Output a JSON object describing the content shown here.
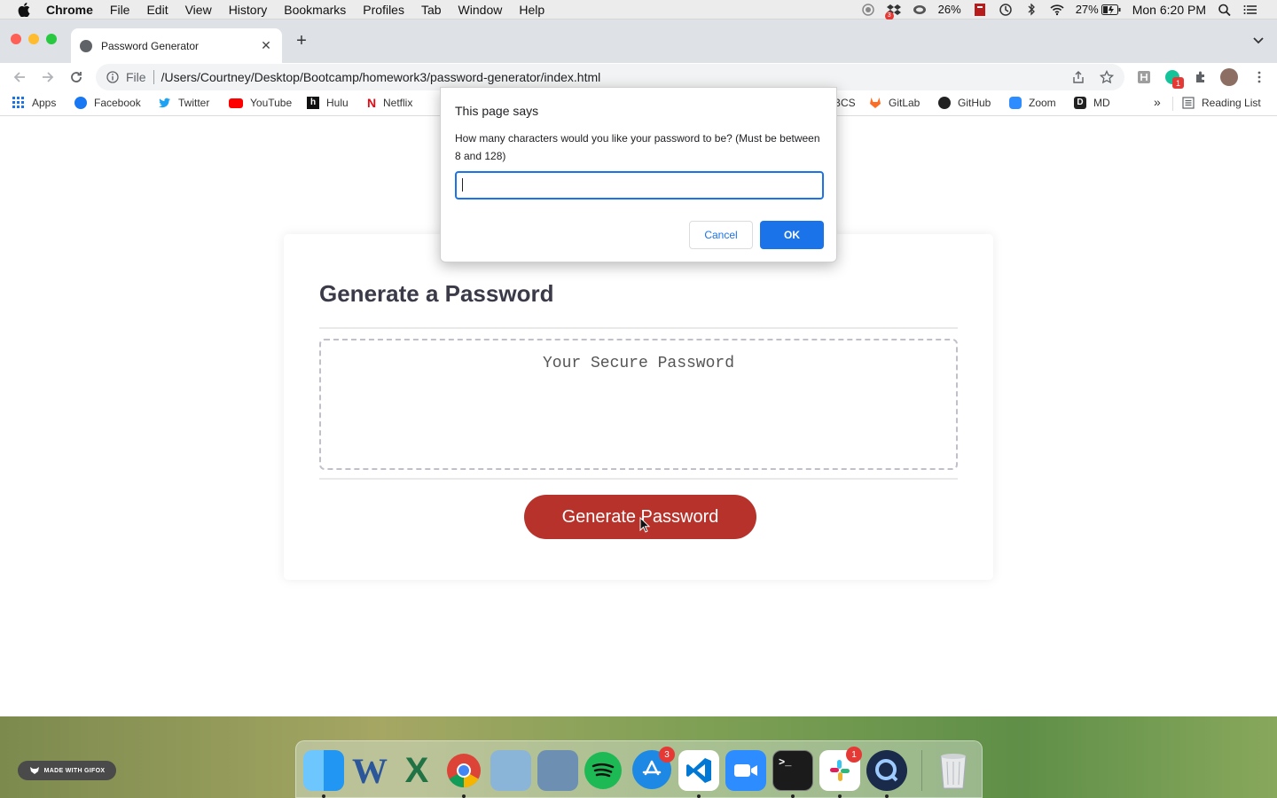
{
  "menubar": {
    "app": "Chrome",
    "items": [
      "File",
      "Edit",
      "View",
      "History",
      "Bookmarks",
      "Profiles",
      "Tab",
      "Window",
      "Help"
    ],
    "battery_a": "26%",
    "battery_b": "27%",
    "clock": "Mon 6:20 PM",
    "dropbox_badge": "3"
  },
  "tab": {
    "title": "Password Generator"
  },
  "omnibox": {
    "scheme": "File",
    "url": "/Users/Courtney/Desktop/Bootcamp/homework3/password-generator/index.html"
  },
  "extensions": {
    "grammarly_badge": "1"
  },
  "bookmarks": {
    "items": [
      "Apps",
      "Facebook",
      "Twitter",
      "YouTube",
      "Hulu",
      "Netflix",
      "BCS",
      "GitLab",
      "GitHub",
      "Zoom",
      "MD"
    ],
    "overflow": "»",
    "reading_list": "Reading List"
  },
  "page": {
    "heading": "Generate a Password",
    "password_placeholder": "Your Secure Password",
    "generate_button": "Generate Password"
  },
  "dialog": {
    "title": "This page says",
    "message": "How many characters would you like your password to be? (Must be between 8 and 128)",
    "input_value": "",
    "cancel": "Cancel",
    "ok": "OK"
  },
  "desktop": {
    "gifox_label": "MADE WITH GIFOX"
  },
  "dock": {
    "word_letter": "W",
    "excel_letter": "X",
    "appstore_badge": "3",
    "slack_badge": "1",
    "terminal_prompt": ">_"
  },
  "colors": {
    "generate_button": "#b6322a",
    "dialog_accent": "#1a73e8",
    "heading": "#3a3a48"
  }
}
